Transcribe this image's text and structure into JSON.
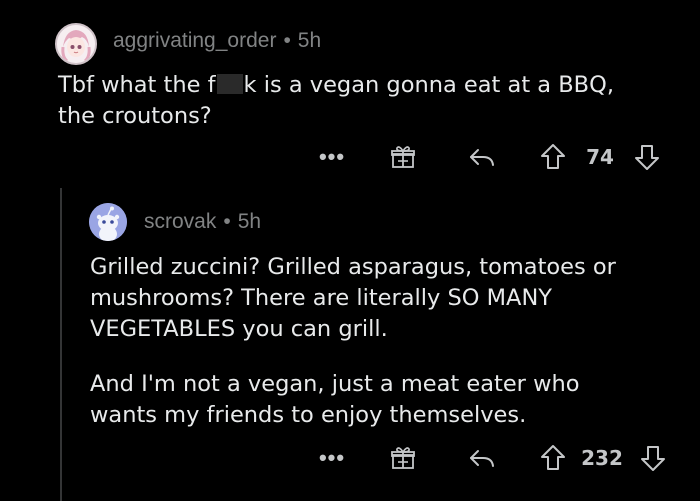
{
  "comments": [
    {
      "username": "aggrivating_order",
      "separator": "•",
      "age": "5h",
      "text_before_censor": "Tbf what the f",
      "text_after_censor": "k is a vegan gonna eat at a BBQ,",
      "text_line2": "the croutons?",
      "more_label": "•••",
      "vote_count": "74"
    },
    {
      "username": "scrovak",
      "separator": "•",
      "age": "5h",
      "paragraphs": [
        "Grilled zuccini? Grilled asparagus, tomatoes or mushrooms? There are literally SO MANY VEGETABLES you can grill.",
        "And I'm not a vegan, just a meat eater who wants my friends to enjoy themselves."
      ],
      "more_label": "•••",
      "vote_count": "232"
    }
  ],
  "icons": {
    "award": "gift-icon",
    "reply": "reply-arrow-icon",
    "upvote": "upvote-arrow-icon",
    "downvote": "downvote-arrow-icon"
  },
  "colors": {
    "background": "#000000",
    "text": "#e8eaeb",
    "meta": "#818384",
    "icon": "#c4c6c8"
  }
}
